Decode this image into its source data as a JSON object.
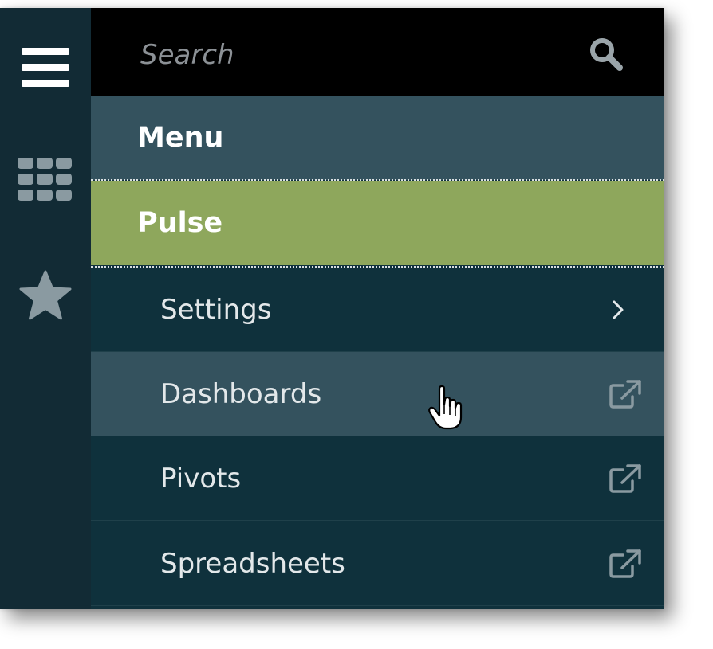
{
  "search": {
    "placeholder": "Search"
  },
  "rail": {
    "items": [
      {
        "icon": "hamburger-icon"
      },
      {
        "icon": "grid-icon"
      },
      {
        "icon": "star-icon"
      }
    ]
  },
  "menu": {
    "header": "Menu",
    "active": "Pulse",
    "items": [
      {
        "label": "Settings",
        "icon": "chevron-right-icon"
      },
      {
        "label": "Dashboards",
        "icon": "external-link-icon"
      },
      {
        "label": "Pivots",
        "icon": "external-link-icon"
      },
      {
        "label": "Spreadsheets",
        "icon": "external-link-icon"
      }
    ]
  },
  "colors": {
    "rail": "#122b35",
    "panel": "#0f313c",
    "header": "#34525e",
    "active": "#8ea75c",
    "search_bar": "#000000"
  }
}
